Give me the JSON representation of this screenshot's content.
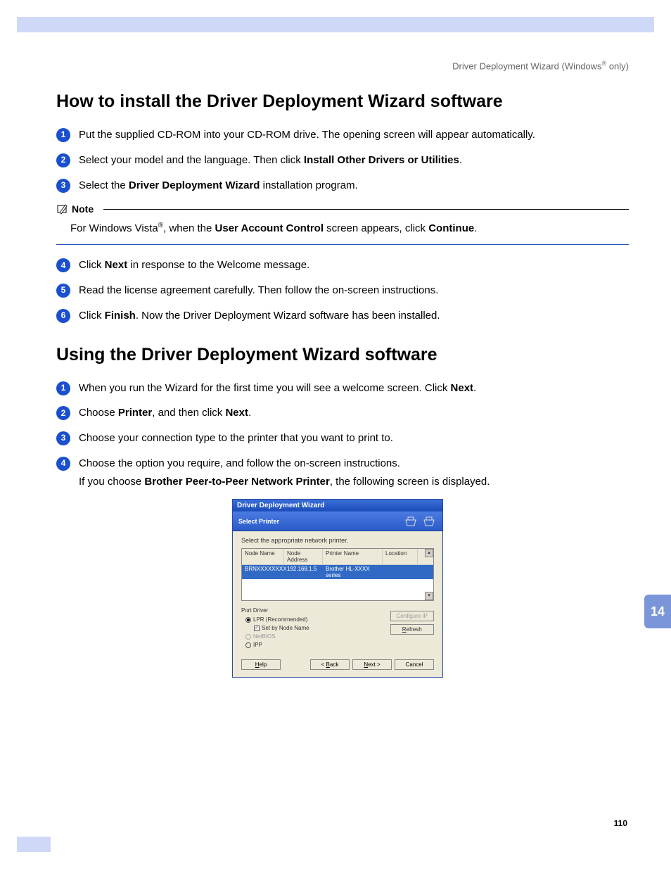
{
  "header": {
    "text_pre": "Driver Deployment Wizard (Windows",
    "text_post": " only)"
  },
  "page_number": "110",
  "side_tab": "14",
  "section1": {
    "title": "How to install the Driver Deployment Wizard software",
    "steps": [
      {
        "n": "1",
        "html": "Put the supplied CD-ROM into your CD-ROM drive. The opening screen will appear automatically."
      },
      {
        "n": "2",
        "html": "Select your model and the language. Then click <b>Install Other Drivers or Utilities</b>."
      },
      {
        "n": "3",
        "html": "Select the <b>Driver Deployment Wizard</b> installation program."
      }
    ],
    "note_label": "Note",
    "note_html": "For Windows Vista<sup>®</sup>, when the <b>User Account Control</b> screen appears, click <b>Continue</b>.",
    "steps_after": [
      {
        "n": "4",
        "html": "Click <b>Next</b> in response to the Welcome message."
      },
      {
        "n": "5",
        "html": "Read the license agreement carefully. Then follow the on-screen instructions."
      },
      {
        "n": "6",
        "html": "Click <b>Finish</b>. Now the Driver Deployment Wizard software has been installed."
      }
    ]
  },
  "section2": {
    "title": "Using the Driver Deployment Wizard software",
    "steps": [
      {
        "n": "1",
        "html": "When you run the Wizard for the first time you will see a welcome screen. Click <b>Next</b>."
      },
      {
        "n": "2",
        "html": "Choose <b>Printer</b>, and then click <b>Next</b>."
      },
      {
        "n": "3",
        "html": "Choose your connection type to the printer that you want to print to."
      },
      {
        "n": "4",
        "html": "Choose the option you require, and follow the on-screen instructions."
      }
    ],
    "indent_html": "If you choose <b>Brother Peer-to-Peer Network Printer</b>, the following screen is displayed."
  },
  "dialog": {
    "title": "Driver Deployment Wizard",
    "subtitle": "Select Printer",
    "instruction": "Select the appropriate network printer.",
    "columns": [
      "Node Name",
      "Node Address",
      "Printer Name",
      "Location"
    ],
    "col_widths": [
      "60px",
      "55px",
      "85px",
      "50px"
    ],
    "row": [
      "BRNXXXXXXXX",
      "192.168.1.5",
      "Brother HL-XXXX series",
      ""
    ],
    "port_group": "Port Driver",
    "radio1": "LPR (Recommended)",
    "check1": "Set by Node Name",
    "radio2": "NetBIOS",
    "radio3": "IPP",
    "btn_configure": "Configure IP",
    "btn_refresh": "Refresh",
    "btn_help": "Help",
    "btn_back": "< Back",
    "btn_next": "Next >",
    "btn_cancel": "Cancel"
  }
}
